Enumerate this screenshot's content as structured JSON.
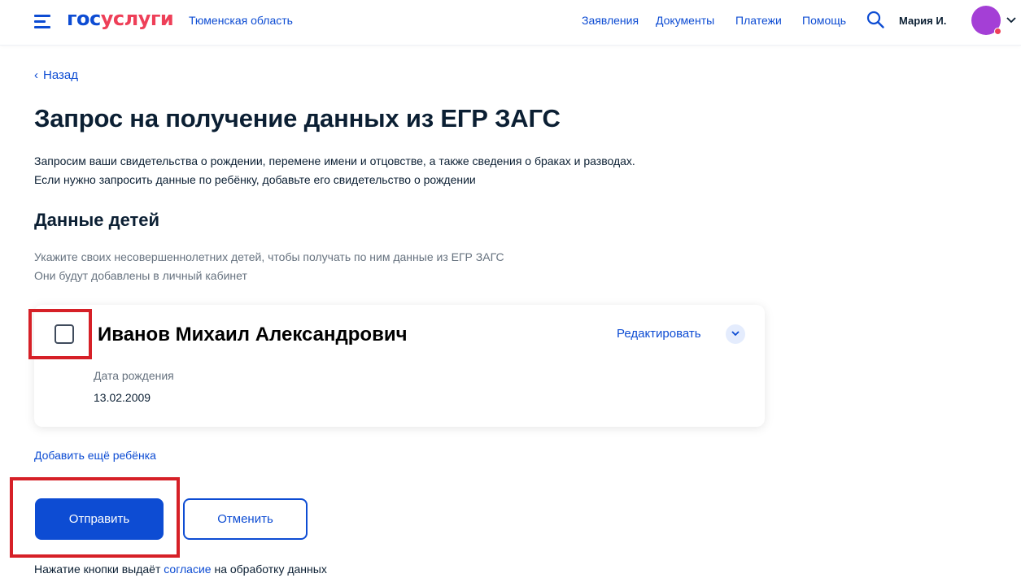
{
  "header": {
    "logo_part1": "гос",
    "logo_part2": "услуги",
    "region": "Тюменская область",
    "nav": [
      {
        "label": "Заявления"
      },
      {
        "label": "Документы"
      },
      {
        "label": "Платежи"
      },
      {
        "label": "Помощь"
      }
    ],
    "user_name": "Мария И."
  },
  "page": {
    "back_label": "Назад",
    "title": "Запрос на получение данных из ЕГР ЗАГС",
    "description_line1": "Запросим ваши свидетельства о рождении, перемене имени и отцовстве, а также сведения о браках и разводах.",
    "description_line2": "Если нужно запросить данные по ребёнку, добавьте его свидетельство о рождении",
    "section_title": "Данные детей",
    "hint_line1": "Укажите своих несовершеннолетних детей, чтобы получать по ним данные из ЕГР ЗАГС",
    "hint_line2": "Они будут добавлены в личный кабинет"
  },
  "child_card": {
    "name": "Иванов Михаил Александрович",
    "edit_label": "Редактировать",
    "dob_label": "Дата рождения",
    "dob_value": "13.02.2009",
    "checked": false
  },
  "actions": {
    "add_child": "Добавить ещё ребёнка",
    "submit": "Отправить",
    "cancel": "Отменить"
  },
  "consent": {
    "prefix": "Нажатие кнопки выдаёт",
    "link": "согласие",
    "suffix": "на обработку данных"
  },
  "colors": {
    "brand_blue": "#0d4cd3",
    "brand_red": "#ee3f58",
    "highlight_red": "#d62027",
    "avatar": "#a43fd6"
  },
  "icons": [
    "burger-menu-icon",
    "search-icon",
    "chevron-down-icon",
    "chevron-left-icon"
  ]
}
